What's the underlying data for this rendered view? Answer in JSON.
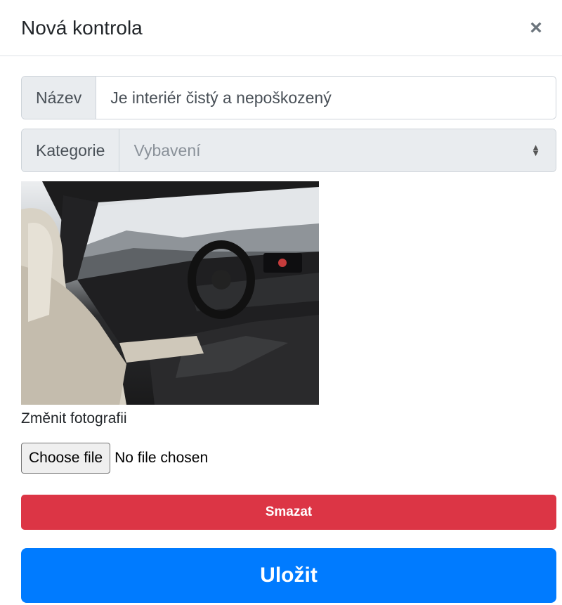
{
  "modal": {
    "title": "Nová kontrola",
    "close_glyph": "×"
  },
  "form": {
    "name_label": "Název",
    "name_value": "Je interiér čistý a nepoškozený",
    "category_label": "Kategorie",
    "category_value": "Vybavení",
    "change_photo_label": "Změnit fotografii",
    "file_button_label": "Choose file",
    "file_status": "No file chosen"
  },
  "actions": {
    "delete_label": "Smazat",
    "save_label": "Uložit"
  },
  "colors": {
    "danger": "#dc3545",
    "primary": "#007bff"
  },
  "icons": {
    "close": "close-icon",
    "select_arrows": "select-arrows-icon"
  }
}
